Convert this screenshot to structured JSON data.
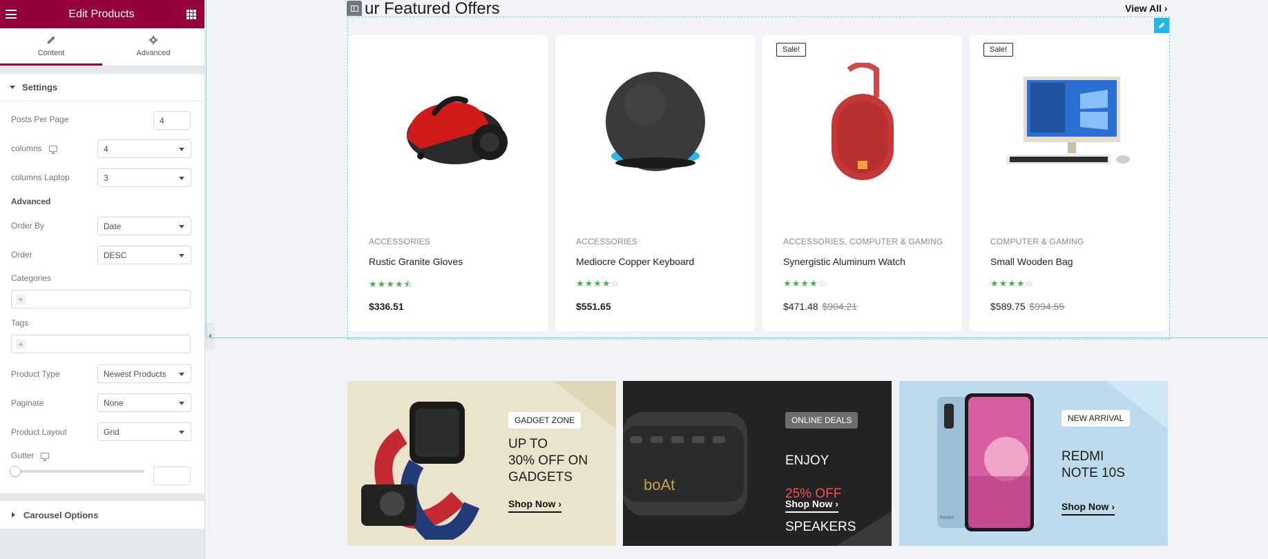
{
  "panel": {
    "title": "Edit Products",
    "tabs": [
      {
        "label": "Content",
        "icon": "pencil-icon"
      },
      {
        "label": "Advanced",
        "icon": "gear-icon"
      }
    ],
    "settings_title": "Settings",
    "posts_per_page": {
      "label": "Posts Per Page",
      "value": "4"
    },
    "columns": {
      "label": "columns",
      "value": "4"
    },
    "columns_laptop": {
      "label": "columns Laptop",
      "value": "3"
    },
    "advanced_heading": "Advanced",
    "order_by": {
      "label": "Order By",
      "value": "Date"
    },
    "order": {
      "label": "Order",
      "value": "DESC"
    },
    "categories": {
      "label": "Categories"
    },
    "tags": {
      "label": "Tags"
    },
    "product_type": {
      "label": "Product Type",
      "value": "Newest Products"
    },
    "paginate": {
      "label": "Paginate",
      "value": "None"
    },
    "product_layout": {
      "label": "Product Layout",
      "value": "Grid"
    },
    "gutter": {
      "label": "Gutter",
      "value": ""
    },
    "carousel_title": "Carousel Options"
  },
  "preview": {
    "heading": "ur Featured Offers",
    "view_all": "View All ›",
    "products": [
      {
        "category": "ACCESSORIES",
        "name": "Rustic Granite Gloves",
        "stars": "★★★★",
        "half": "⯪",
        "empty": "",
        "price": "$336.51",
        "old_price": "",
        "sale": "",
        "image": "vacuum-cleaner-image"
      },
      {
        "category": "ACCESSORIES",
        "name": "Mediocre Copper Keyboard",
        "stars": "★★★★",
        "half": "",
        "empty": "☆",
        "price": "$551.65",
        "old_price": "",
        "sale": "",
        "image": "smart-speaker-image"
      },
      {
        "category": "ACCESSORIES, COMPUTER & GAMING",
        "name": "Synergistic Aluminum Watch",
        "stars": "★★★★",
        "half": "",
        "empty": "☆",
        "price": "$471.48",
        "old_price": "$904.21",
        "sale": "Sale!",
        "image": "bluetooth-speaker-image"
      },
      {
        "category": "COMPUTER & GAMING",
        "name": "Small Wooden Bag",
        "stars": "★★★★",
        "half": "",
        "empty": "☆",
        "price": "$589.75",
        "old_price": "$994.55",
        "sale": "Sale!",
        "image": "desktop-computer-image"
      }
    ],
    "banners": [
      {
        "badge": "GADGET ZONE",
        "headline": "UP TO\n30% OFF ON\nGADGETS",
        "cta": "Shop Now ›",
        "bg": "#ebe4cc"
      },
      {
        "badge": "ONLINE DEALS",
        "headline_1": "ENJOY",
        "headline_2": "25% OFF",
        "headline_3": "SPEAKERS",
        "cta": "Shop Now ›",
        "bg": "#232323",
        "accent": "#ff4a57",
        "logo": "boAt"
      },
      {
        "badge": "NEW ARRIVAL",
        "headline": "REDMI\nNOTE 10S",
        "cta": "Shop Now ›",
        "bg": "#bedbee",
        "phone_brand": "Redmi"
      }
    ]
  },
  "colors": {
    "brand": "#93003c",
    "editor_accent": "#21b6ea",
    "star": "#4caf50"
  }
}
